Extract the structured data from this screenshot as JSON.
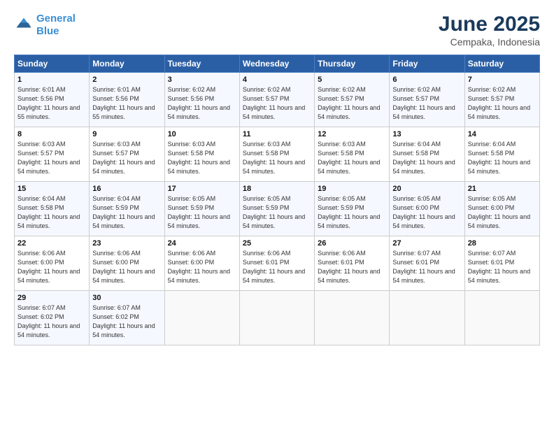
{
  "header": {
    "logo_line1": "General",
    "logo_line2": "Blue",
    "month": "June 2025",
    "location": "Cempaka, Indonesia"
  },
  "days_of_week": [
    "Sunday",
    "Monday",
    "Tuesday",
    "Wednesday",
    "Thursday",
    "Friday",
    "Saturday"
  ],
  "weeks": [
    [
      {
        "num": "1",
        "rise": "6:01 AM",
        "set": "5:56 PM",
        "daylight": "11 hours and 55 minutes."
      },
      {
        "num": "2",
        "rise": "6:01 AM",
        "set": "5:56 PM",
        "daylight": "11 hours and 55 minutes."
      },
      {
        "num": "3",
        "rise": "6:02 AM",
        "set": "5:56 PM",
        "daylight": "11 hours and 54 minutes."
      },
      {
        "num": "4",
        "rise": "6:02 AM",
        "set": "5:57 PM",
        "daylight": "11 hours and 54 minutes."
      },
      {
        "num": "5",
        "rise": "6:02 AM",
        "set": "5:57 PM",
        "daylight": "11 hours and 54 minutes."
      },
      {
        "num": "6",
        "rise": "6:02 AM",
        "set": "5:57 PM",
        "daylight": "11 hours and 54 minutes."
      },
      {
        "num": "7",
        "rise": "6:02 AM",
        "set": "5:57 PM",
        "daylight": "11 hours and 54 minutes."
      }
    ],
    [
      {
        "num": "8",
        "rise": "6:03 AM",
        "set": "5:57 PM",
        "daylight": "11 hours and 54 minutes."
      },
      {
        "num": "9",
        "rise": "6:03 AM",
        "set": "5:57 PM",
        "daylight": "11 hours and 54 minutes."
      },
      {
        "num": "10",
        "rise": "6:03 AM",
        "set": "5:58 PM",
        "daylight": "11 hours and 54 minutes."
      },
      {
        "num": "11",
        "rise": "6:03 AM",
        "set": "5:58 PM",
        "daylight": "11 hours and 54 minutes."
      },
      {
        "num": "12",
        "rise": "6:03 AM",
        "set": "5:58 PM",
        "daylight": "11 hours and 54 minutes."
      },
      {
        "num": "13",
        "rise": "6:04 AM",
        "set": "5:58 PM",
        "daylight": "11 hours and 54 minutes."
      },
      {
        "num": "14",
        "rise": "6:04 AM",
        "set": "5:58 PM",
        "daylight": "11 hours and 54 minutes."
      }
    ],
    [
      {
        "num": "15",
        "rise": "6:04 AM",
        "set": "5:58 PM",
        "daylight": "11 hours and 54 minutes."
      },
      {
        "num": "16",
        "rise": "6:04 AM",
        "set": "5:59 PM",
        "daylight": "11 hours and 54 minutes."
      },
      {
        "num": "17",
        "rise": "6:05 AM",
        "set": "5:59 PM",
        "daylight": "11 hours and 54 minutes."
      },
      {
        "num": "18",
        "rise": "6:05 AM",
        "set": "5:59 PM",
        "daylight": "11 hours and 54 minutes."
      },
      {
        "num": "19",
        "rise": "6:05 AM",
        "set": "5:59 PM",
        "daylight": "11 hours and 54 minutes."
      },
      {
        "num": "20",
        "rise": "6:05 AM",
        "set": "6:00 PM",
        "daylight": "11 hours and 54 minutes."
      },
      {
        "num": "21",
        "rise": "6:05 AM",
        "set": "6:00 PM",
        "daylight": "11 hours and 54 minutes."
      }
    ],
    [
      {
        "num": "22",
        "rise": "6:06 AM",
        "set": "6:00 PM",
        "daylight": "11 hours and 54 minutes."
      },
      {
        "num": "23",
        "rise": "6:06 AM",
        "set": "6:00 PM",
        "daylight": "11 hours and 54 minutes."
      },
      {
        "num": "24",
        "rise": "6:06 AM",
        "set": "6:00 PM",
        "daylight": "11 hours and 54 minutes."
      },
      {
        "num": "25",
        "rise": "6:06 AM",
        "set": "6:01 PM",
        "daylight": "11 hours and 54 minutes."
      },
      {
        "num": "26",
        "rise": "6:06 AM",
        "set": "6:01 PM",
        "daylight": "11 hours and 54 minutes."
      },
      {
        "num": "27",
        "rise": "6:07 AM",
        "set": "6:01 PM",
        "daylight": "11 hours and 54 minutes."
      },
      {
        "num": "28",
        "rise": "6:07 AM",
        "set": "6:01 PM",
        "daylight": "11 hours and 54 minutes."
      }
    ],
    [
      {
        "num": "29",
        "rise": "6:07 AM",
        "set": "6:02 PM",
        "daylight": "11 hours and 54 minutes."
      },
      {
        "num": "30",
        "rise": "6:07 AM",
        "set": "6:02 PM",
        "daylight": "11 hours and 54 minutes."
      },
      null,
      null,
      null,
      null,
      null
    ]
  ]
}
